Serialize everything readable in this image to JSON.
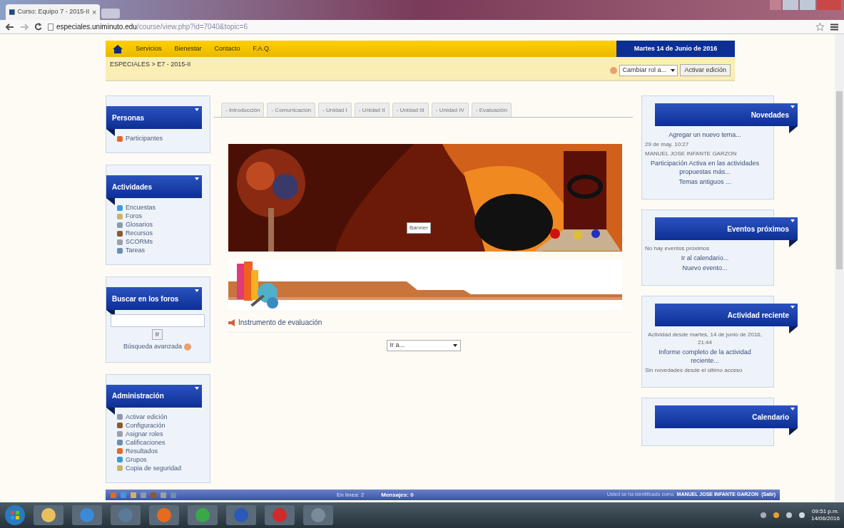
{
  "browser": {
    "tab_title": "Curso: Equipo 7 - 2015-II",
    "tab_close": "×",
    "url_host": "especiales.uniminuto.edu",
    "url_path": "/course/view.php?id=7040&topic=6"
  },
  "nav": {
    "items": [
      "Servicios",
      "Bienestar",
      "Contacto",
      "F.A.Q."
    ],
    "date": "Martes 14 de Junio de 2016"
  },
  "breadcrumb": {
    "path": "ESPECIALES > E7 - 2015-II",
    "role_select": "Cambiar rol a...",
    "edit_button": "Activar edición"
  },
  "left_blocks": [
    {
      "title": "Personas",
      "kind": "list",
      "items": [
        "Participantes"
      ]
    },
    {
      "title": "Actividades",
      "kind": "list",
      "items": [
        "Encuestas",
        "Foros",
        "Glosarios",
        "Recursos",
        "SCORMs",
        "Tareas"
      ]
    },
    {
      "title": "Buscar en los foros",
      "kind": "search",
      "button": "Ir",
      "link": "Búsqueda avanzada"
    },
    {
      "title": "Administración",
      "kind": "list",
      "items": [
        "Activar edición",
        "Configuración",
        "Asignar roles",
        "Calificaciones",
        "Resultados",
        "Grupos",
        "Copia de seguridad"
      ]
    }
  ],
  "tabs": [
    "- Introducción",
    "- Comunicación",
    "- Unidad I",
    "- Unidad II",
    "- Unidad III",
    "- Unidad IV",
    "- Evaluación"
  ],
  "content": {
    "tooltip": "Banner",
    "activity": "Instrumento de evaluación",
    "jump_select": "Ir a..."
  },
  "right_blocks": [
    {
      "title": "Novedades",
      "lines": [
        {
          "kind": "link",
          "text": "Agregar un nuevo tema..."
        },
        {
          "kind": "text",
          "text": "29 de may, 10:27"
        },
        {
          "kind": "text",
          "text": "MANUEL JOSE INFANTE GARZON"
        },
        {
          "kind": "link",
          "text": "Participación Activa en las actividades propuestas más..."
        },
        {
          "kind": "link",
          "text": "Temas antiguos ..."
        }
      ]
    },
    {
      "title": "Eventos próximos",
      "lines": [
        {
          "kind": "text",
          "text": "No hay eventos próximos"
        },
        {
          "kind": "link",
          "text": "Ir al calendario..."
        },
        {
          "kind": "link",
          "text": "Nuevo evento..."
        }
      ]
    },
    {
      "title": "Actividad reciente",
      "lines": [
        {
          "kind": "center",
          "text": "Actividad desde martes, 14 de junio de 2016, 21:44"
        },
        {
          "kind": "link",
          "text": "Informe completo de la actividad reciente..."
        },
        {
          "kind": "text",
          "text": "Sin novedades desde el último acceso"
        }
      ]
    },
    {
      "title": "Calendario"
    }
  ],
  "dock": {
    "online": "En línea: 2",
    "messages": "Mensajes: 0",
    "login": "Usted se ha identificado como",
    "user": "MANUEL JOSE INFANTE GARZON",
    "logout": "(Salir)"
  },
  "taskbar": {
    "time": "09:51 p.m.",
    "date": "14/06/2016"
  }
}
